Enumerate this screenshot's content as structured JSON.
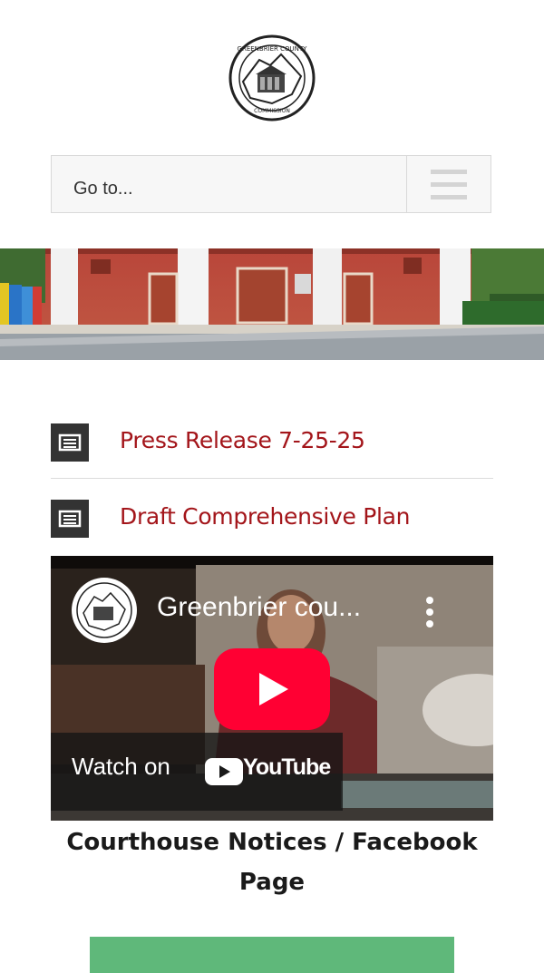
{
  "logo": {
    "text_top": "GREENBRIER COUNTY",
    "text_bottom": "COMMISSION"
  },
  "nav": {
    "label": "Go to..."
  },
  "banner": {
    "alt": ""
  },
  "posts": [
    {
      "title": "Press Release 7-25-25"
    },
    {
      "title": "Draft Comprehensive Plan"
    }
  ],
  "video": {
    "title": "Greenbrier cou...",
    "watch_on": "Watch on",
    "youtube": "YouTube"
  },
  "section": {
    "heading": "Courthouse Notices / Facebook Page"
  },
  "colors": {
    "link": "#a3151a",
    "green": "#5fb87a",
    "youtube_red": "#ff0033",
    "icon_bg": "#333333"
  }
}
